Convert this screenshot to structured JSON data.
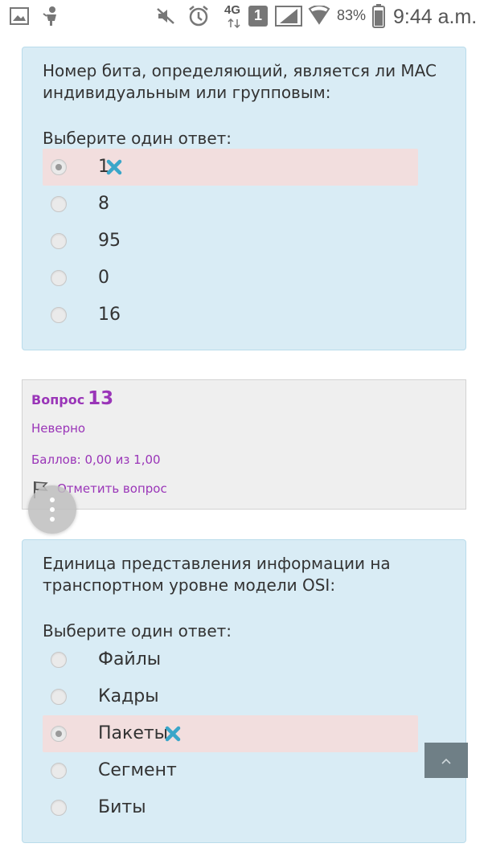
{
  "status_bar": {
    "network": "4G",
    "sim": "1",
    "battery": "83%",
    "time": "9:44 a.m."
  },
  "q12": {
    "text_line1": "Номер бита, определяющий, является ли MAC",
    "text_line2": "индивидуальным или групповым:",
    "prompt": "Выберите один ответ:",
    "options": [
      {
        "label": "1",
        "selected": true,
        "wrong": true
      },
      {
        "label": "8"
      },
      {
        "label": "95"
      },
      {
        "label": "0"
      },
      {
        "label": "16"
      }
    ]
  },
  "q13_info": {
    "question_label": "Вопрос",
    "question_number": "13",
    "state": "Неверно",
    "grade": "Баллов: 0,00 из 1,00",
    "flag_label": "Отметить вопрос"
  },
  "q13": {
    "text_line1": "Единица представления информации на",
    "text_line2": "транспортном уровне модели OSI:",
    "prompt": "Выберите один ответ:",
    "options": [
      {
        "label": "Файлы"
      },
      {
        "label": "Кадры"
      },
      {
        "label": "Пакеты",
        "selected": true,
        "wrong": true
      },
      {
        "label": "Сегмент"
      },
      {
        "label": "Биты"
      }
    ]
  },
  "colors": {
    "card_bg": "#d9ecf5",
    "wrong_bg": "#f2dede",
    "info_text": "#9a35b8",
    "incorrect_mark": "#3aa6c9"
  }
}
